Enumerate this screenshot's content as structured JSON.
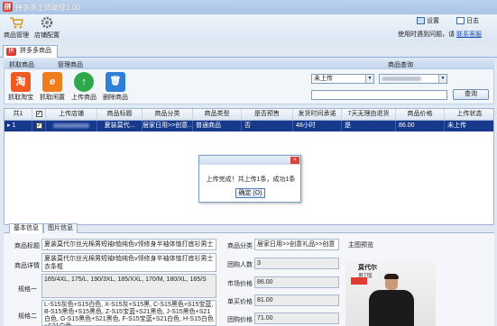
{
  "window": {
    "title": "拼多多上货助理1.00",
    "logo_glyph": "拼"
  },
  "toolbar": {
    "product_manage": "商品管理",
    "store_config": "店铺配置",
    "settings": "设置",
    "log": "日志",
    "help_text": "使用时遇到问题，请",
    "contact_link": "联系客服"
  },
  "tab": {
    "label": "拼多多商品",
    "close": "×"
  },
  "sections": {
    "grab": "抓取商品",
    "manage": "管理商品",
    "query": "商品查询"
  },
  "actions": [
    {
      "label": "抓取淘宝",
      "glyph": "淘",
      "color": "#f05a22"
    },
    {
      "label": "抓取闲置",
      "glyph": "e",
      "color": "#f07d1b"
    },
    {
      "label": "上传商品",
      "glyph": "↑",
      "color": "#2ea84a"
    },
    {
      "label": "删除商品",
      "glyph": "🗑",
      "color": "#2f7fd6"
    }
  ],
  "query": {
    "status_value": "未上传",
    "store_value": "",
    "search_value": "",
    "search_button": "查询"
  },
  "grid": {
    "headers": [
      "共1",
      "☑",
      "上传店铺",
      "商品标题",
      "商品分类",
      "商品类型",
      "是否预售",
      "发货时间承诺",
      "7天无理由退货",
      "商品价格",
      "上传状态"
    ],
    "rows": [
      {
        "index": "1",
        "checked": true,
        "store": "",
        "title": "夏装莫代...",
        "category": "居家日用>>创意...",
        "type": "普通商品",
        "presale": "否",
        "ship_time": "48小时",
        "return7": "是",
        "price": "86.00",
        "status": "未上传"
      }
    ]
  },
  "dialog": {
    "close": "×",
    "message": "上传完成！共上传1条，成功1条",
    "ok_button": "确定 (O)"
  },
  "bottom_tabs": {
    "basic": "基本信息",
    "images": "图片信息"
  },
  "detail": {
    "title_label": "商品标题",
    "title_value": "夏装莫代尔丝光棉男短袖t恤纯色v领修身半袖体恤打底衫男士衣",
    "desc_label": "商品详情",
    "desc_value": "夏装莫代尔丝光棉男短袖t恤纯色v领修身半袖体恤打底衫男士衣条框",
    "spec1_label": "规格一",
    "spec1_value": "165/4XL, 175/L, 190/3XL, 185/XXL, 170/M, 180/XL, 165/S",
    "spec2_label": "规格二",
    "spec2_value": "L-S15灰色+S15白色, X-S15灰+S15黑, C-S15黑色+S15宝蓝, B-S15黑色+S15黑色, Z-S15宝蓝+S21黑色, J-S15黑色+S21白色, G-S15黑色+S21黑色, F-S15宝蓝+S21白色, H-S15白色+S21白色",
    "category_label": "商品分类",
    "category_value": "居家日用>>创意礼品>>创意",
    "group_label": "团购人数",
    "group_value": "3",
    "market_label": "市场价格",
    "market_value": "86.00",
    "single_label": "单买价格",
    "single_value": "81.00",
    "group_price_label": "团购价格",
    "group_price_value": "71.00",
    "main_pic_label": "主图预览",
    "brand_text": "莫代尔",
    "brand_sub": "男T恤"
  }
}
